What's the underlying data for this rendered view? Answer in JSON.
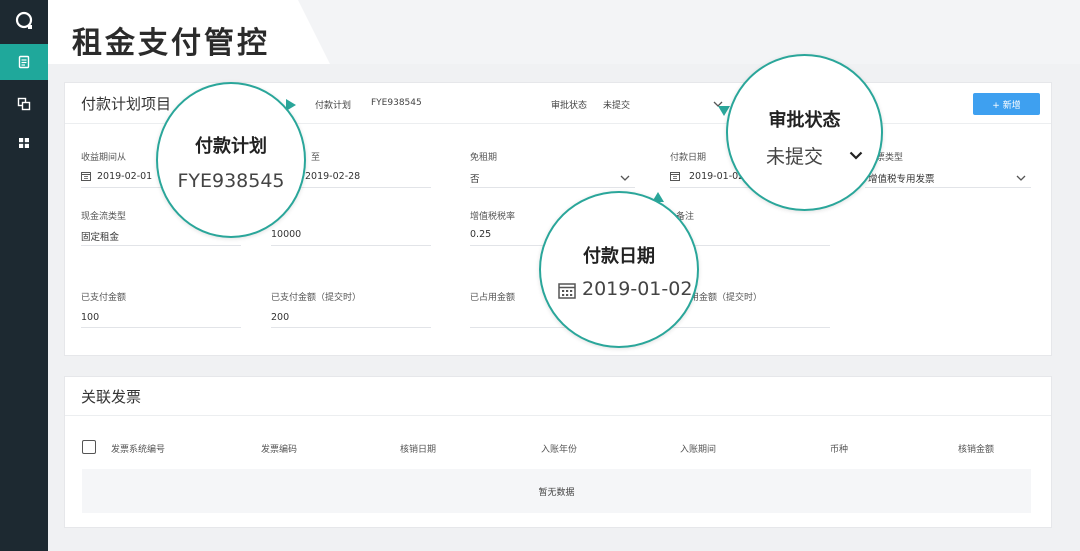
{
  "page": {
    "title": "租金支付管控"
  },
  "sidebar": {
    "items": [
      {
        "name": "document",
        "icon": "document-icon",
        "active": true
      },
      {
        "name": "copy",
        "icon": "copy-icon",
        "active": false
      },
      {
        "name": "grid",
        "icon": "grid-icon",
        "active": false
      }
    ]
  },
  "plan": {
    "title": "付款计划项目",
    "plan_label": "付款计划",
    "plan_value": "FYE938545",
    "status_label": "审批状态",
    "status_value": "未提交",
    "add_button": "+ 新增",
    "fields": {
      "income_from_label": "收益期间从",
      "income_from_value": "2019-02-01",
      "income_to_label": "至",
      "income_to_value": "2019-02-28",
      "rent_free_label": "免租期",
      "rent_free_value": "否",
      "pay_date_label": "付款日期",
      "pay_date_value": "2019-01-02",
      "invoice_type_label": "票类型",
      "invoice_type_value": "增值税专用发票",
      "cashflow_label": "现金流类型",
      "cashflow_value": "固定租金",
      "amount_value": "10000",
      "vat_label": "增值税税率",
      "vat_value": "0.25",
      "note_label": "备注",
      "paid_label": "已支付金额",
      "paid_value": "100",
      "paid_submit_label": "已支付金额（提交时）",
      "paid_submit_value": "200",
      "occupied_label": "已占用金额",
      "occupied_submit_label": "用金额（提交时）"
    }
  },
  "invoice": {
    "title": "关联发票",
    "columns": [
      "发票系统编号",
      "发票编码",
      "核销日期",
      "入账年份",
      "入账期间",
      "币种",
      "核销金额"
    ],
    "empty_text": "暂无数据"
  },
  "callouts": {
    "plan": {
      "title": "付款计划",
      "value": "FYE938545"
    },
    "status": {
      "title": "审批状态",
      "value": "未提交"
    },
    "date": {
      "title": "付款日期",
      "value": "2019-01-02"
    }
  },
  "colors": {
    "accent": "#2aa69a",
    "sidebar": "#1d2931",
    "button": "#3ea0f0"
  }
}
